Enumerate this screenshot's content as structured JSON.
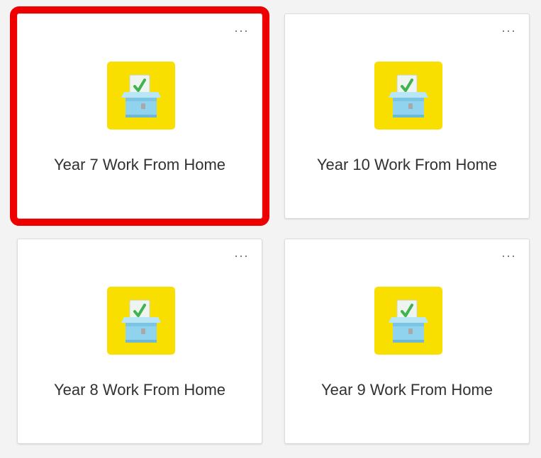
{
  "colors": {
    "tile_bg": "#f9df00",
    "selection": "#ee0000",
    "ballot_box": "#8fd3ef",
    "check": "#3fb34f"
  },
  "cards": [
    {
      "title": "Year 7 Work From Home",
      "icon": "ballot-box-icon",
      "more_icon": "more-options-icon",
      "selected": true
    },
    {
      "title": "Year 10 Work From Home",
      "icon": "ballot-box-icon",
      "more_icon": "more-options-icon",
      "selected": false
    },
    {
      "title": "Year 8 Work From Home",
      "icon": "ballot-box-icon",
      "more_icon": "more-options-icon",
      "selected": false
    },
    {
      "title": "Year 9 Work From Home",
      "icon": "ballot-box-icon",
      "more_icon": "more-options-icon",
      "selected": false
    }
  ]
}
